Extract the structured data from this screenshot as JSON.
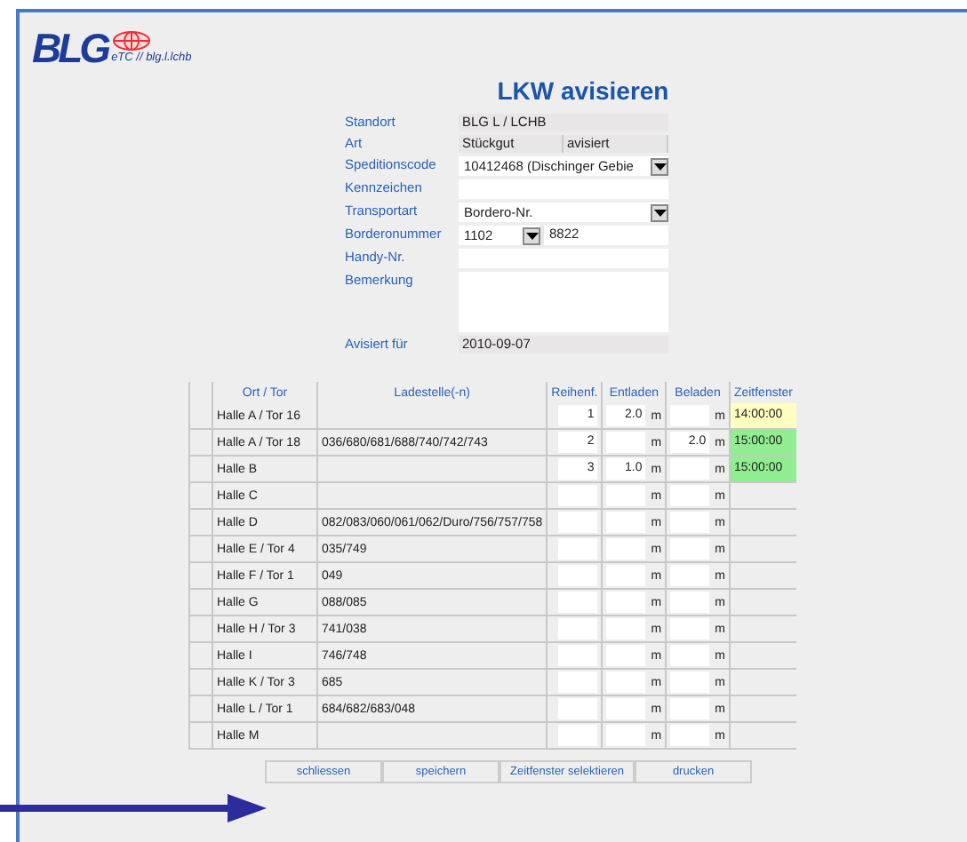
{
  "logo": {
    "brand": "BLG",
    "subtitle": "eTC // blg.l.lchb"
  },
  "title": "LKW avisieren",
  "form": [
    {
      "label": "Standort",
      "kind": "text",
      "value": "BLG L / LCHB"
    },
    {
      "label": "Art",
      "kind": "pair",
      "values": [
        "Stückgut",
        "avisiert"
      ]
    },
    {
      "label": "Speditionscode",
      "kind": "select",
      "value": "10412468 (Dischinger Gebie"
    },
    {
      "label": "Kennzeichen",
      "kind": "input"
    },
    {
      "label": "Transportart",
      "kind": "select",
      "value": "Bordero-Nr."
    },
    {
      "label": "Borderonummer",
      "kind": "split",
      "value": "1102",
      "second": "8822"
    },
    {
      "label": "Handy-Nr.",
      "kind": "input"
    },
    {
      "label": "Bemerkung",
      "kind": "textarea"
    },
    {
      "label": "Avisiert für",
      "kind": "text",
      "value": "2010-09-07"
    }
  ],
  "table": {
    "columns": [
      "Ort / Tor",
      "Ladestelle(-n)",
      "Reihenf.",
      "Entladen",
      "Beladen",
      "Zeitfenster"
    ],
    "rows": [
      {
        "ort": "Halle A / Tor 16",
        "reihenfolge": "1",
        "entladen": "2.0",
        "entladen_unit": "m",
        "beladen_unit": "m",
        "zeitfenster": "14:00:00",
        "color": "#ffffc0"
      },
      {
        "ort": "Halle A / Tor 18",
        "ladestelle": "036/680/681/688/740/742/743",
        "reihenfolge": "2",
        "entladen_unit": "m",
        "beladen": "2.0",
        "beladen_unit": "m",
        "zeitfenster": "15:00:00",
        "color": "#90ee90"
      },
      {
        "ort": "Halle B",
        "reihenfolge": "3",
        "entladen": "1.0",
        "entladen_unit": "m",
        "beladen_unit": "m",
        "zeitfenster": "15:00:00",
        "color": "#90ee90"
      },
      {
        "ort": "Halle C",
        "entladen_unit": "m",
        "beladen_unit": "m"
      },
      {
        "ort": "Halle D",
        "ladestelle": "082/083/060/061/062/Duro/756/757/758",
        "entladen_unit": "m",
        "beladen_unit": "m"
      },
      {
        "ort": "Halle E / Tor 4",
        "ladestelle": "035/749",
        "entladen_unit": "m",
        "beladen_unit": "m"
      },
      {
        "ort": "Halle F / Tor 1",
        "ladestelle": "049",
        "entladen_unit": "m",
        "beladen_unit": "m"
      },
      {
        "ort": "Halle G",
        "ladestelle": "088/085",
        "entladen_unit": "m",
        "beladen_unit": "m"
      },
      {
        "ort": "Halle H / Tor 3",
        "ladestelle": "741/038",
        "entladen_unit": "m",
        "beladen_unit": "m"
      },
      {
        "ort": "Halle I",
        "ladestelle": "746/748",
        "entladen_unit": "m",
        "beladen_unit": "m"
      },
      {
        "ort": "Halle K / Tor 3",
        "ladestelle": "685",
        "entladen_unit": "m",
        "beladen_unit": "m"
      },
      {
        "ort": "Halle L / Tor 1",
        "ladestelle": "684/682/683/048",
        "entladen_unit": "m",
        "beladen_unit": "m"
      },
      {
        "ort": "Halle M",
        "entladen_unit": "m",
        "beladen_unit": "m"
      }
    ]
  },
  "buttons": [
    "schliessen",
    "speichern",
    "Zeitfenster selektieren",
    "drucken"
  ]
}
